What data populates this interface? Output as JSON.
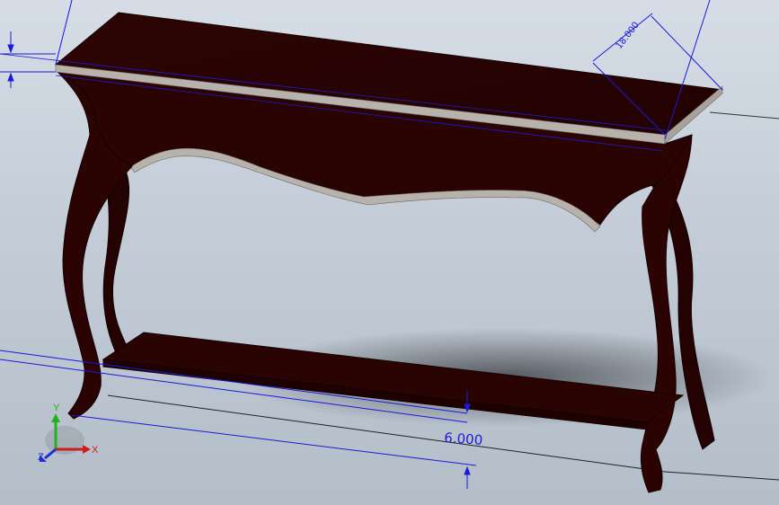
{
  "viewport": {
    "background_top": "#d6dde6",
    "background_bottom": "#b4bec9",
    "model_color": "#2a0303",
    "edge_color": "#170000",
    "highlight_color": "#b8b2ac",
    "dimension_color": "#1a1ad8"
  },
  "dimensions": {
    "depth_value": "18.000",
    "thickness_value": "6.000"
  },
  "triad": {
    "x_label": "X",
    "y_label": "Y",
    "z_label": "Z",
    "x_color": "#d01c1c",
    "y_color": "#20b020",
    "z_color": "#2030d0"
  }
}
